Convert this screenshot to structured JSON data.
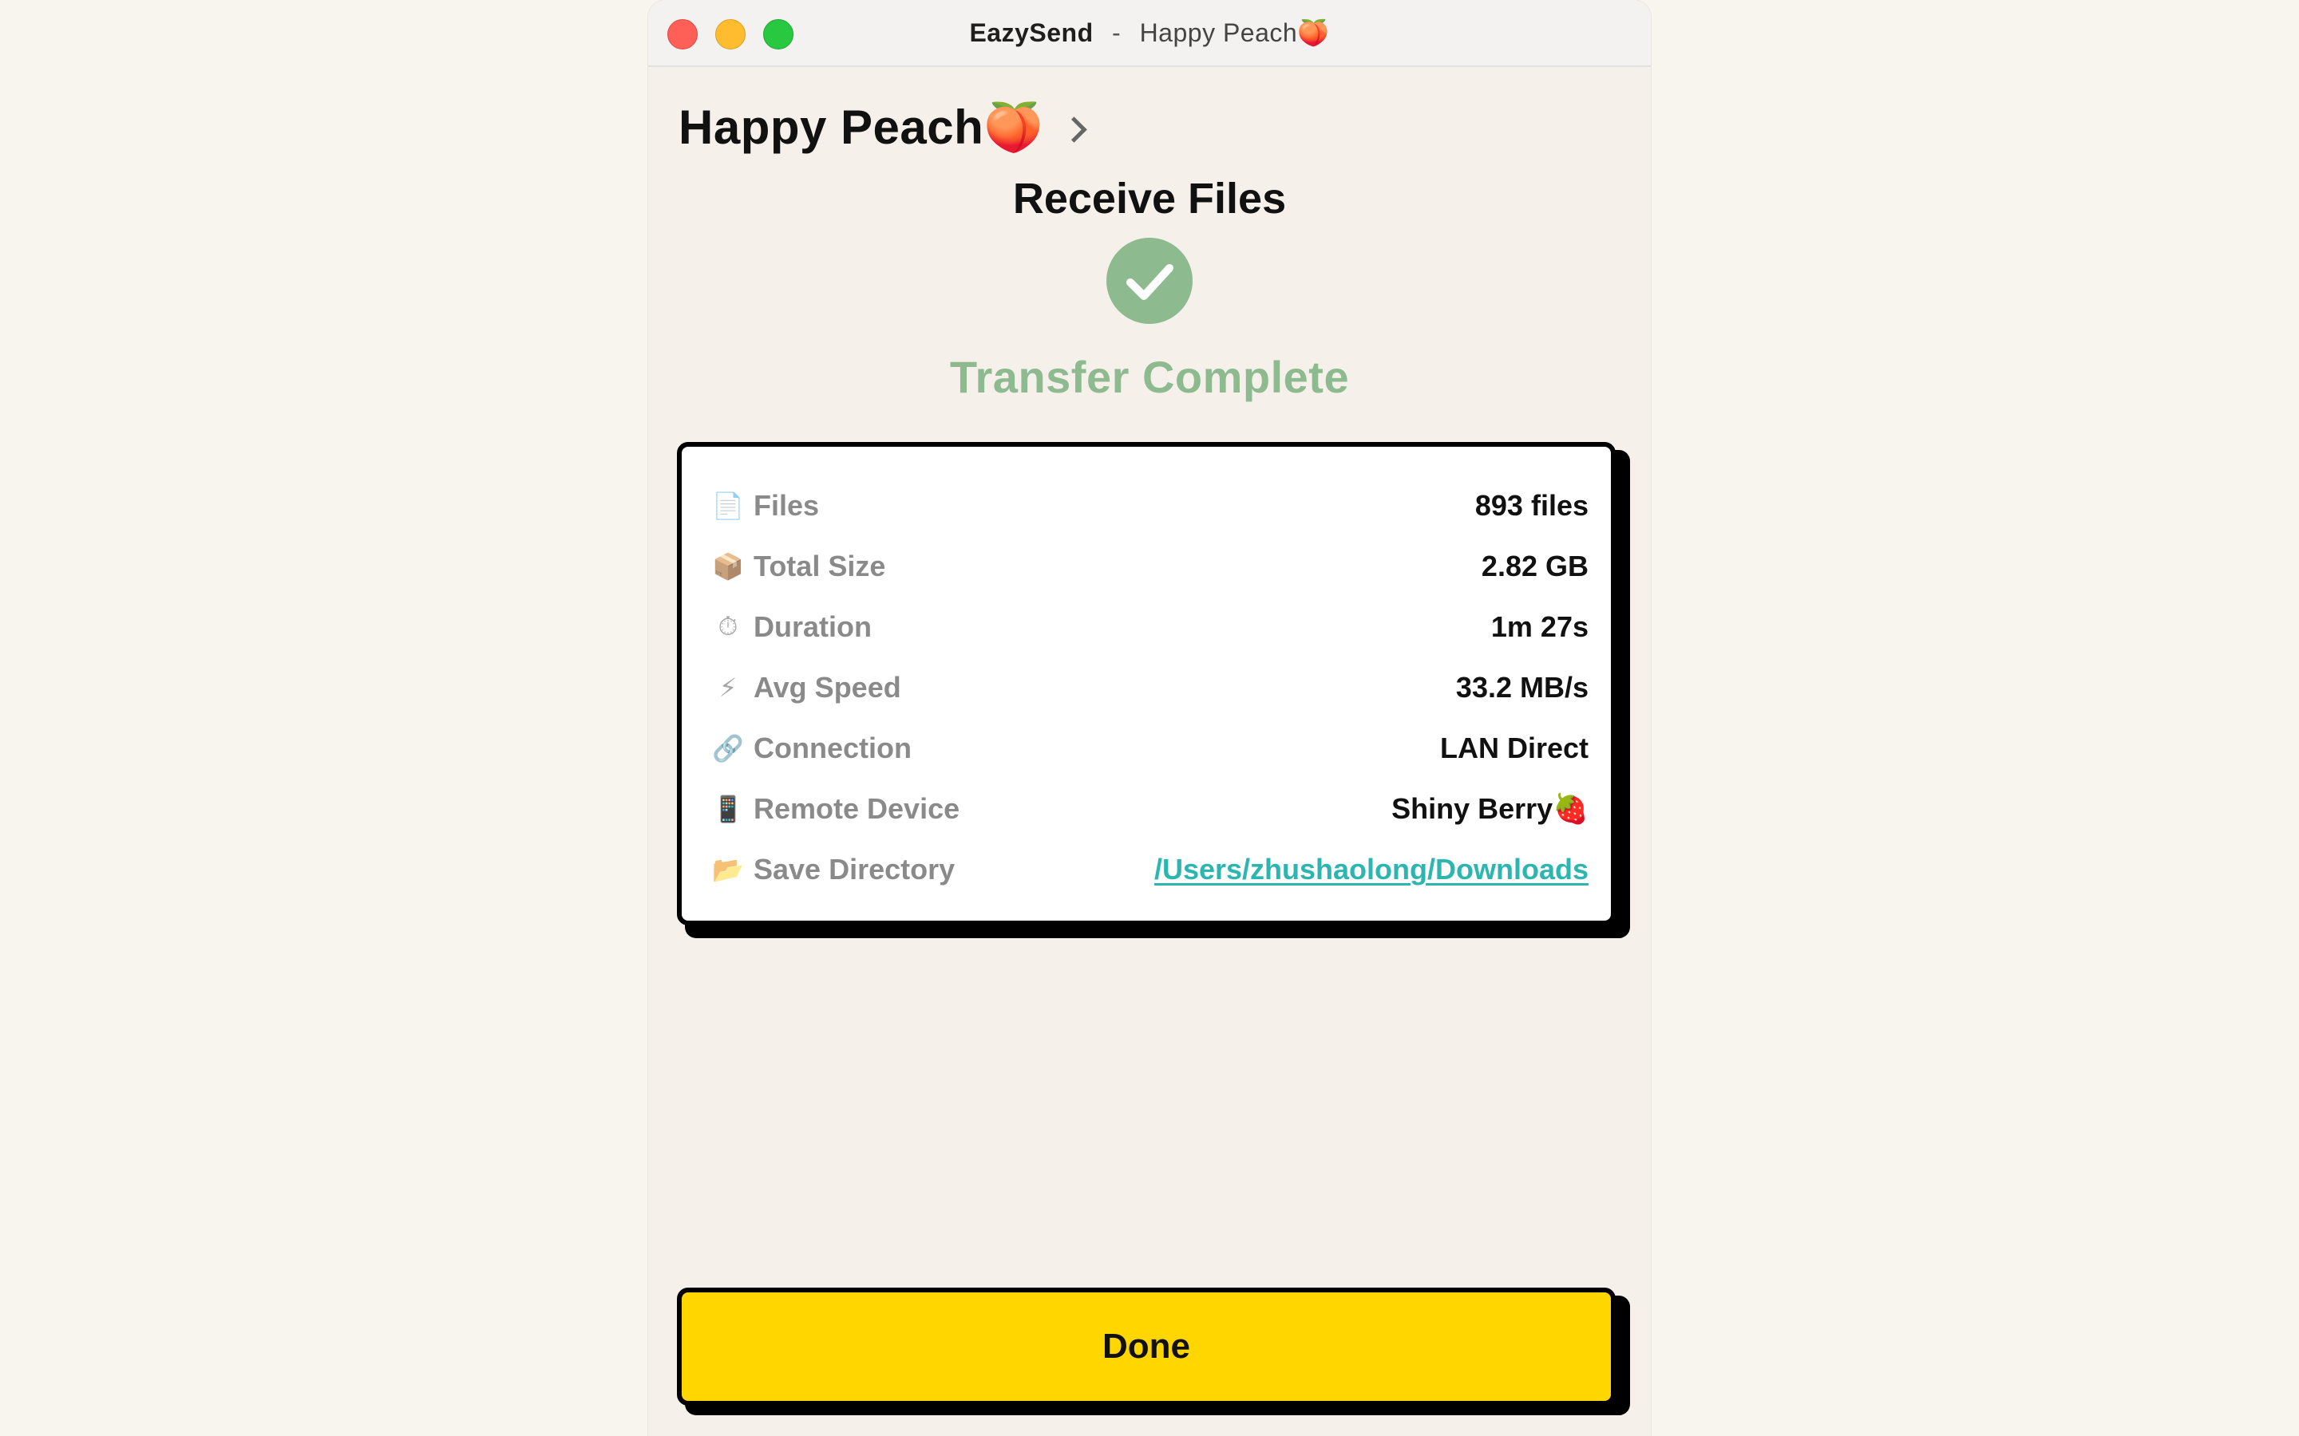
{
  "window": {
    "app_name": "EazySend",
    "separator": "-",
    "device_title": "Happy Peach🍑"
  },
  "header": {
    "device_name": "Happy Peach🍑"
  },
  "main": {
    "section_title": "Receive Files",
    "status": "Transfer Complete",
    "status_color": "#8dba8f",
    "stats": [
      {
        "icon": "📄",
        "icon_name": "file-icon",
        "label": "Files",
        "value": "893 files"
      },
      {
        "icon": "📦",
        "icon_name": "package-icon",
        "label": "Total Size",
        "value": "2.82 GB"
      },
      {
        "icon": "⏱",
        "icon_name": "stopwatch-icon",
        "label": "Duration",
        "value": "1m 27s"
      },
      {
        "icon": "⚡",
        "icon_name": "lightning-icon",
        "label": "Avg Speed",
        "value": "33.2 MB/s"
      },
      {
        "icon": "🔗",
        "icon_name": "link-icon",
        "label": "Connection",
        "value": "LAN Direct"
      },
      {
        "icon": "📱",
        "icon_name": "phone-icon",
        "label": "Remote Device",
        "value": "Shiny Berry🍓"
      },
      {
        "icon": "📂",
        "icon_name": "folder-icon",
        "label": "Save Directory",
        "value": "/Users/zhushaolong/Downloads"
      }
    ]
  },
  "actions": {
    "done_label": "Done",
    "done_color": "#ffd600"
  },
  "colors": {
    "link": "#2db5b0",
    "background": "#f5f1ea"
  }
}
